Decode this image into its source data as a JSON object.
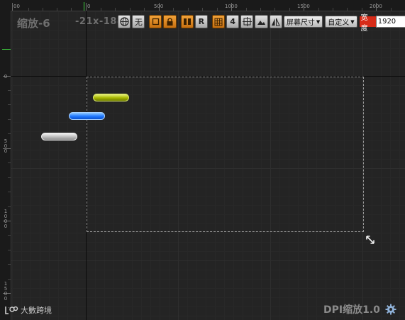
{
  "overlay": {
    "zoom": "缩放-6",
    "coords": "-21x-188",
    "dpi": "DPI缩放1.0"
  },
  "toolbar": {
    "globe_icon": "globe-icon",
    "none_label": "无",
    "orange_square_icon": "square-outline-icon",
    "lock_icon": "lock-icon",
    "columns_icon": "columns-icon",
    "r_label": "R",
    "grid_icon": "grid-icon",
    "snap_label": "4",
    "anchor_icon": "anchor-icon",
    "mountain_icon": "image-icon",
    "mirror_icon": "mirror-icon",
    "screen_size_label": "屏幕尺寸",
    "custom_label": "自定义",
    "width_label": "宽度",
    "width_value": "1920",
    "accent_orange": "#e08a1c",
    "accent_red": "#d62b18"
  },
  "ruler": {
    "top_labels": [
      "00",
      "0",
      "500",
      "1000",
      "1500",
      "2000"
    ],
    "left_labels": [
      "0",
      "500",
      "1000",
      "1500"
    ]
  },
  "widgets": {
    "bar_colors": [
      "#a7b700",
      "#1f78ff",
      "#bdbdbd"
    ]
  },
  "brand": {
    "name": "大數跨境"
  }
}
